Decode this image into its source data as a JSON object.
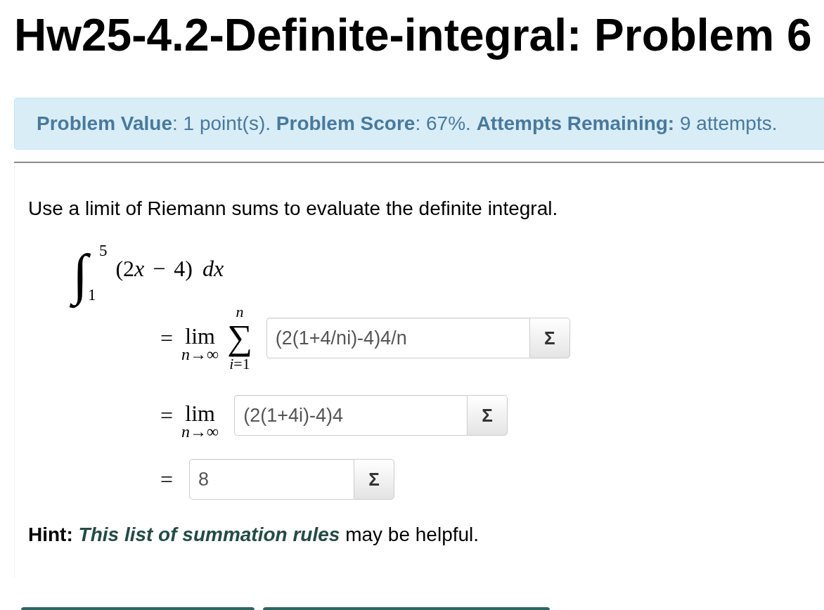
{
  "page_title": "Hw25-4.2-Definite-integral: Problem 6",
  "status": {
    "text": "**Problem Value**: 1 point(s). **Problem Score**: 67%. **Attempts Remaining:** 9 attempts."
  },
  "problem": {
    "statement": "Use a limit of Riemann sums to evaluate the definite integral.",
    "integral": {
      "symbol": "∫",
      "upper": "5",
      "lower": "1",
      "integrand": [
        {
          "kind": "text",
          "text": "(2"
        },
        {
          "kind": "variable",
          "text": "x"
        },
        {
          "kind": "text",
          "text": " − 4)"
        }
      ],
      "differential": "dx"
    },
    "steps": [
      {
        "kind": "limit-sum",
        "relation": "=",
        "limit": "lim",
        "limit_under": "*n*→∞",
        "sum_symbol": "∑",
        "sum_upper": "n",
        "sum_lower": "*i*=1",
        "answer": "(2(1+4/ni)-4)4/n",
        "button": "Σ"
      },
      {
        "kind": "limit",
        "relation": "=",
        "limit": "lim",
        "limit_under": "*n*→∞",
        "answer": "(2(1+4i)-4)4",
        "button": "Σ"
      },
      {
        "kind": "plain",
        "relation": "=",
        "answer": "8",
        "button": "Σ"
      }
    ],
    "hint": {
      "label": "Hint:",
      "link": "This list of summation rules",
      "rest": "may be helpful."
    }
  },
  "bottom_buttons": [
    {
      "kind": "button"
    },
    {
      "kind": "button"
    }
  ]
}
